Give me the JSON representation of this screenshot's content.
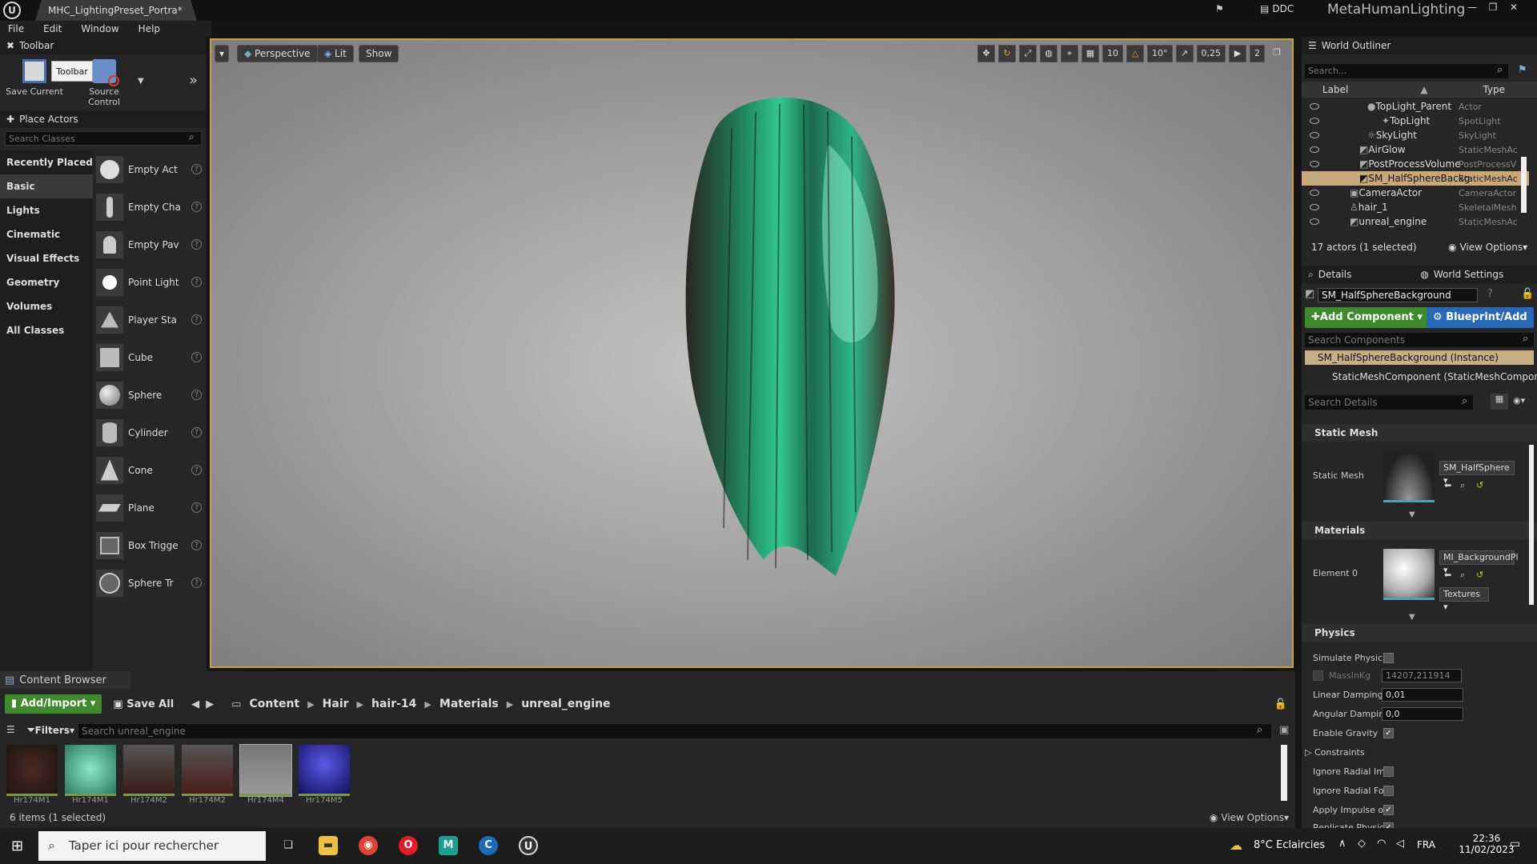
{
  "titlebar": {
    "tab": "MHC_LightingPreset_Portra*",
    "ddc": "DDC",
    "project": "MetaHumanLighting"
  },
  "menu": [
    "File",
    "Edit",
    "Window",
    "Help"
  ],
  "toolbar": {
    "tab": "Toolbar",
    "save_current": "Save Current",
    "tooltip": "Toolbar",
    "source_control": "Source Control"
  },
  "place_actors": {
    "tab": "Place Actors",
    "search_placeholder": "Search Classes",
    "categories": [
      "Recently Placed",
      "Basic",
      "Lights",
      "Cinematic",
      "Visual Effects",
      "Geometry",
      "Volumes",
      "All Classes"
    ],
    "items": [
      "Empty Act",
      "Empty Cha",
      "Empty Pav",
      "Point Light",
      "Player Sta",
      "Cube",
      "Sphere",
      "Cylinder",
      "Cone",
      "Plane",
      "Box Trigge",
      "Sphere Tr"
    ]
  },
  "viewport": {
    "perspective": "Perspective",
    "lit": "Lit",
    "show": "Show",
    "grid": "10",
    "angle": "10°",
    "scale": "0,25",
    "camera_speed": "2"
  },
  "content_browser": {
    "tab": "Content Browser",
    "add_import": "Add/Import",
    "save_all": "Save All",
    "path": [
      "Content",
      "Hair",
      "hair-14",
      "Materials",
      "unreal_engine"
    ],
    "filters": "Filters",
    "search_placeholder": "Search unreal_engine",
    "assets": [
      "Hr174M1",
      "Hr174M1",
      "Hr174M2",
      "Hr174M2",
      "Hr174M4",
      "Hr174M5"
    ],
    "status": "6 items (1 selected)",
    "view_options": "View Options"
  },
  "outliner": {
    "tab": "World Outliner",
    "search_placeholder": "Search...",
    "col_label": "Label",
    "col_type": "Type",
    "rows": [
      {
        "label": "TopLight_Parent",
        "type": "Actor"
      },
      {
        "label": "TopLight",
        "type": "SpotLight"
      },
      {
        "label": "SkyLight",
        "type": "SkyLight"
      },
      {
        "label": "AirGlow",
        "type": "StaticMeshAc"
      },
      {
        "label": "PostProcessVolume",
        "type": "PostProcessV"
      },
      {
        "label": "SM_HalfSphereBackg",
        "type": "StaticMeshAc"
      },
      {
        "label": "CameraActor",
        "type": "CameraActor"
      },
      {
        "label": "hair_1",
        "type": "SkeletalMesh"
      },
      {
        "label": "unreal_engine",
        "type": "StaticMeshAc"
      }
    ],
    "status": "17 actors (1 selected)",
    "view_options": "View Options"
  },
  "details": {
    "tab_details": "Details",
    "tab_world": "World Settings",
    "name": "SM_HalfSphereBackground",
    "add_component": "Add Component",
    "blueprint": "Blueprint/Add",
    "search_components": "Search Components",
    "instance": "SM_HalfSphereBackground (Instance)",
    "component": "StaticMeshComponent (StaticMeshComponent)",
    "search_details": "Search Details",
    "static_mesh_section": "Static Mesh",
    "static_mesh_label": "Static Mesh",
    "static_mesh_value": "SM_HalfSphere",
    "materials_section": "Materials",
    "element0": "Element 0",
    "material_value": "MI_BackgroundPl",
    "textures": "Textures",
    "physics_section": "Physics",
    "simulate": "Simulate Physic",
    "mass": "MassInKg",
    "mass_value": "14207,211914",
    "linear": "Linear Damping",
    "linear_value": "0,01",
    "angular": "Angular Dampin",
    "angular_value": "0,0",
    "gravity": "Enable Gravity",
    "constraints": "Constraints",
    "radial_impulse": "Ignore Radial Im",
    "radial_force": "Ignore Radial Fo",
    "apply_impulse": "Apply Impulse o",
    "replicate": "Replicate Physic"
  },
  "taskbar": {
    "search": "Taper ici pour rechercher",
    "weather": "8°C  Eclaircies",
    "lang": "FRA",
    "time": "22:36",
    "date": "11/02/2023"
  }
}
